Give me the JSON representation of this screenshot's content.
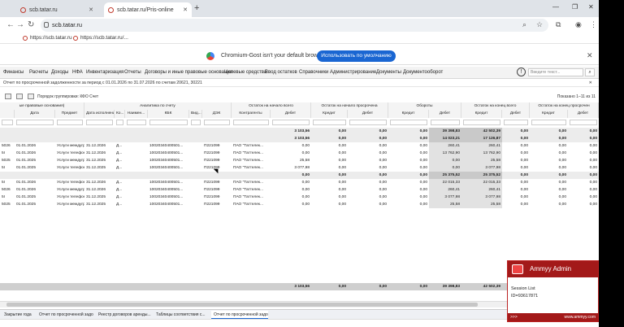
{
  "browser": {
    "tabs": [
      {
        "title": "scb.tatar.ru"
      },
      {
        "title": "scb.tatar.ru/Pris-online"
      }
    ],
    "url": "scb.tatar.ru",
    "bookmarks": [
      "https://scb.tatar.ru",
      "https://scb.tatar.ru/..."
    ],
    "infobar_text": "Chromium-Gost isn't your default browser",
    "infobar_button": "Использовать по умолчанию"
  },
  "app": {
    "menu": [
      "Финансы",
      "Расчеты",
      "Доходы",
      "НФА",
      "Инвентаризация",
      "Отчеты",
      "Договоры и иные правовые основания",
      "Целевые средства",
      "Ввод остатков",
      "Справочники",
      "Администрирование",
      "Документы",
      "Документооборот"
    ],
    "search_placeholder": "Введите текст...",
    "report_title": "Отчет по просроченной задолженности за период с 01.01.2026 по 31.07.2026 по счетам 20621, 30221",
    "grouping": "Порядок группировки: КФО  Счет",
    "shown": "Показано 1–11 из 11"
  },
  "grid": {
    "header_groups": [
      "ые правовые основания)",
      "Аналитика по счету",
      "Остаток на начало всего",
      "Остаток на начало просрочена",
      "Обороты",
      "Остаток на конец всего",
      "Остаток на конец просрочен"
    ],
    "columns": [
      "Дата",
      "Предмет",
      "Дата исполнения",
      "Ко...",
      "Наимен...",
      "КБК",
      "Вид...",
      "ДЭК",
      "Контрагенты",
      "Дебет",
      "Кредит",
      "Дебет",
      "Кредит",
      "Дебет",
      "Кредит",
      "Дебет",
      "Кредит",
      "Дебет",
      "Кредит"
    ],
    "summary_rows": [
      [
        "3 103,56",
        "0,00",
        "0,00",
        "0,00",
        "39 398,83",
        "42 502,39",
        "0,00",
        "0,00",
        "0,00",
        "0,00"
      ],
      [
        "3 103,56",
        "0,00",
        "0,00",
        "0,00",
        "14 023,21",
        "17 126,87",
        "0,00",
        "0,00",
        "0,00",
        "0,00"
      ]
    ],
    "rows_group1": [
      {
        "id": "5026",
        "date": "01.01.2026",
        "subj": "Услуги междугр...",
        "exec": "31.12.2026",
        "k": "Д...",
        "kbk": "10020340400501...",
        "dek": "П221099",
        "agent": "ПАО \"Таттелек...",
        "v": [
          "0,00",
          "0,00",
          "0,00",
          "0,00",
          "260,41",
          "260,41",
          "0,00",
          "0,00",
          "0,00",
          "0,00"
        ]
      },
      {
        "id": "5I",
        "date": "01.01.2026",
        "subj": "Услуги телефон...",
        "exec": "31.12.2026",
        "k": "Д...",
        "kbk": "10020340400501...",
        "dek": "П221099",
        "agent": "ПАО \"Таттелек...",
        "v": [
          "0,00",
          "0,00",
          "0,00",
          "0,00",
          "13 762,90",
          "13 762,90",
          "0,00",
          "0,00",
          "0,00",
          "0,00"
        ]
      },
      {
        "id": "5025",
        "date": "01.01.2025",
        "subj": "Услуги междугр...",
        "exec": "31.12.2025",
        "k": "Д...",
        "kbk": "10020340400501...",
        "dek": "П221099",
        "agent": "ПАО \"Таттелек...",
        "v": [
          "25,58",
          "0,00",
          "0,00",
          "0,00",
          "0,00",
          "25,58",
          "0,00",
          "0,00",
          "0,00",
          "0,00"
        ]
      },
      {
        "id": "5I",
        "date": "01.01.2025",
        "subj": "Услуги телефон...",
        "exec": "31.12.2025",
        "k": "Д...",
        "kbk": "10020340400501...",
        "dek": "П221099",
        "agent": "ПАО \"Таттелек...",
        "v": [
          "3 077,98",
          "0,00",
          "0,00",
          "0,00",
          "0,00",
          "3 077,98",
          "0,00",
          "0,00",
          "0,00",
          "0,00"
        ]
      }
    ],
    "mid_total": [
      "0,00",
      "0,00",
      "0,00",
      "0,00",
      "25 375,52",
      "25 375,52",
      "0,00",
      "0,00",
      "0,00",
      "0,00"
    ],
    "rows_group2": [
      {
        "id": "5I",
        "date": "01.01.2026",
        "subj": "Услуги телефон...",
        "exec": "31.12.2026",
        "k": "Д...",
        "kbk": "10020340400501...",
        "dek": "П221099",
        "agent": "ПАО \"Таттелек...",
        "v": [
          "0,00",
          "0,00",
          "0,00",
          "0,00",
          "22 015,33",
          "22 015,33",
          "0,00",
          "0,00",
          "0,00",
          "0,00"
        ]
      },
      {
        "id": "5026",
        "date": "01.01.2026",
        "subj": "Услуги междугр...",
        "exec": "31.12.2026",
        "k": "Д...",
        "kbk": "10020340400501...",
        "dek": "П221099",
        "agent": "ПАО \"Таттелек...",
        "v": [
          "0,00",
          "0,00",
          "0,00",
          "0,00",
          "260,41",
          "260,41",
          "0,00",
          "0,00",
          "0,00",
          "0,00"
        ]
      },
      {
        "id": "5I",
        "date": "01.01.2025",
        "subj": "Услуги телефон...",
        "exec": "31.12.2025",
        "k": "Д...",
        "kbk": "10020340400501...",
        "dek": "П221099",
        "agent": "ПАО \"Таттелек...",
        "v": [
          "0,00",
          "0,00",
          "0,00",
          "0,00",
          "3 077,98",
          "3 077,98",
          "0,00",
          "0,00",
          "0,00",
          "0,00"
        ]
      },
      {
        "id": "5025",
        "date": "01.01.2025",
        "subj": "Услуги междугр...",
        "exec": "31.12.2025",
        "k": "Д...",
        "kbk": "10020340400501...",
        "dek": "П221099",
        "agent": "ПАО \"Таттелек...",
        "v": [
          "0,00",
          "0,00",
          "0,00",
          "0,00",
          "25,58",
          "25,58",
          "0,00",
          "0,00",
          "0,00",
          "0,00"
        ]
      }
    ],
    "footer_total": [
      "3 103,56",
      "0,00",
      "0,00",
      "0,00",
      "39 398,83",
      "42 502,39",
      "0,00",
      "0,00",
      "0,00",
      "0,00"
    ]
  },
  "taskbar": [
    "Закрытие года",
    "Отчет по просроченной задо...",
    "Реестр договоров аренды...",
    "Таблицы соответствия с...",
    "Отчет по просроченной задо..."
  ],
  "ammyy": {
    "title": "Ammyy Admin",
    "line1": "Session List",
    "line2": "ID=93617871",
    "foot_left": ">>>",
    "foot_link": "www.ammyy.com"
  }
}
